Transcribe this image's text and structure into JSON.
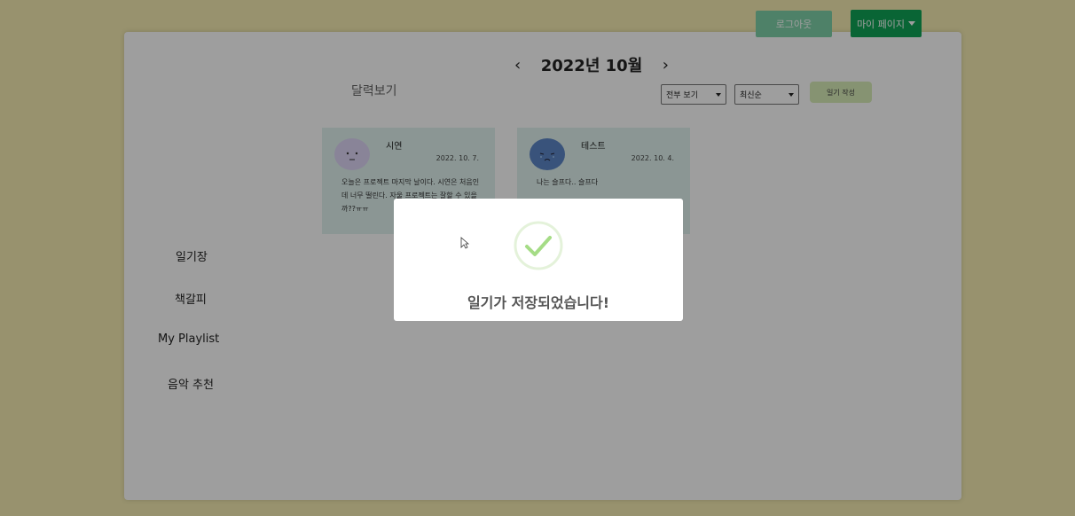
{
  "header": {
    "logout_label": "로그아웃",
    "mypage_label": "마이 페이지"
  },
  "calendar": {
    "prev_icon": "‹",
    "month_label": "2022년 10월",
    "next_icon": "›",
    "calendar_view_label": "달력보기"
  },
  "filters": {
    "view_select": "전부 보기",
    "sort_select": "최신순",
    "write_label": "일기 작성"
  },
  "cards": [
    {
      "title": "시연",
      "date": "2022. 10. 7.",
      "body": "오늘은 프로젝트 마지막 날이다. 시연은 처음인데 너무 떨린다. 자울 프로젝트는 잘할 수 있을까??ㅠㅠ"
    },
    {
      "title": "테스트",
      "date": "2022. 10. 4.",
      "body": "나는 슬프다.. 슬프다"
    }
  ],
  "sidebar": {
    "items": [
      "일기장",
      "책갈피",
      "My Playlist",
      "음악 추천"
    ]
  },
  "modal": {
    "message": "일기가 저장되었습니다!",
    "icon": "check-icon",
    "check_color": "#a5dc86"
  }
}
